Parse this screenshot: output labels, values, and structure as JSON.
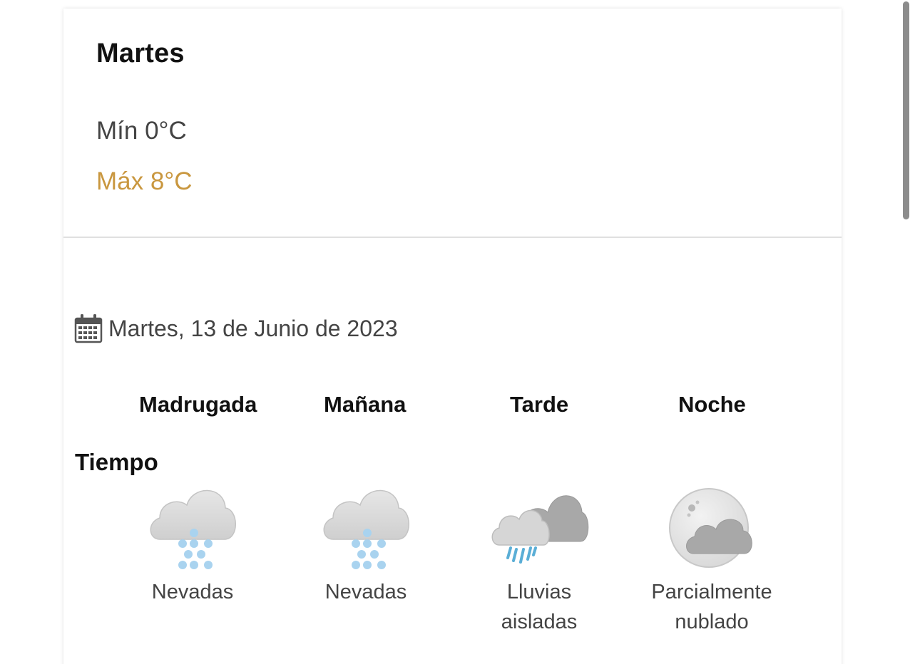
{
  "day": {
    "title": "Martes",
    "min": "Mín 0°C",
    "max": "Máx 8°C"
  },
  "date": {
    "icon": "calendar-icon",
    "text": "Martes, 13 de Junio de 2023"
  },
  "periods": [
    "Madrugada",
    "Mañana",
    "Tarde",
    "Noche"
  ],
  "section": {
    "label": "Tiempo"
  },
  "weather": [
    {
      "icon": "snow-cloud-icon",
      "desc_line1": "Nevadas",
      "desc_line2": ""
    },
    {
      "icon": "snow-cloud-icon",
      "desc_line1": "Nevadas",
      "desc_line2": ""
    },
    {
      "icon": "rain-cloud-icon",
      "desc_line1": "Lluvias",
      "desc_line2": "aisladas"
    },
    {
      "icon": "moon-cloud-icon",
      "desc_line1": "Parcialmente",
      "desc_line2": "nublado"
    }
  ],
  "colors": {
    "max_temp": "#c9973f",
    "text": "#444444",
    "heading": "#111111"
  }
}
